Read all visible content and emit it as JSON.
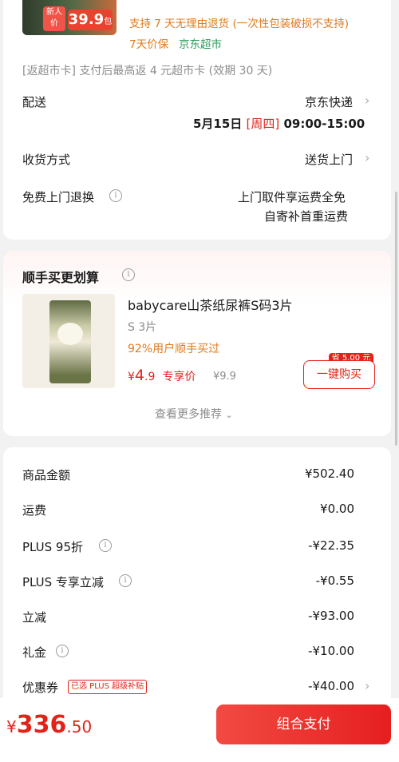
{
  "product_top": {
    "badge_new": "新人价",
    "badge_price_main": "39.9",
    "badge_price_unit": "包",
    "return_policy": "支持 7 天无理由退货 (一次性包装破损不支持)",
    "price_protect": "7天价保",
    "store": "京东超市"
  },
  "rebate_note": "[返超市卡] 支付后最高返 4 元超市卡 (效期 30 天)",
  "delivery": {
    "label": "配送",
    "carrier": "京东快递",
    "date": "5月15日",
    "weekday": "[周四]",
    "time": "09:00-15:00"
  },
  "receive": {
    "label": "收货方式",
    "value": "送货上门"
  },
  "free_return": {
    "label": "免费上门退换",
    "line1": "上门取件享运费全免",
    "line2": "自寄补首重运费"
  },
  "reco": {
    "title": "顺手买更划算",
    "product_name": "babycare山茶纸尿裤S码3片",
    "spec": "S  3片",
    "popularity": "92%用户顺手买过",
    "price_symbol": "¥",
    "price_int": "4",
    "price_dec": ".9",
    "price_tag": "专享价",
    "orig_price": "¥9.9",
    "save_badge": "省 5.00 元",
    "buy_button": "一键购买",
    "more": "查看更多推荐"
  },
  "summary": [
    {
      "label": "商品金额",
      "value": "¥502.40"
    },
    {
      "label": "运费",
      "value": "¥0.00"
    },
    {
      "label": "PLUS 95折",
      "value": "-¥22.35"
    },
    {
      "label": "PLUS 专享立减",
      "value": "-¥0.55"
    },
    {
      "label": "立减",
      "value": "-¥93.00"
    },
    {
      "label": "礼金",
      "value": "-¥10.00"
    },
    {
      "label": "优惠券",
      "value": "-¥40.00",
      "tag": "已选 PLUS 超级补贴"
    }
  ],
  "total": {
    "currency": "¥",
    "integer": "336",
    "decimal": ".50"
  },
  "pay_button": "组合支付",
  "colors": {
    "accent": "#e2231a",
    "orange": "#e07a1d",
    "green": "#2a9d58"
  }
}
